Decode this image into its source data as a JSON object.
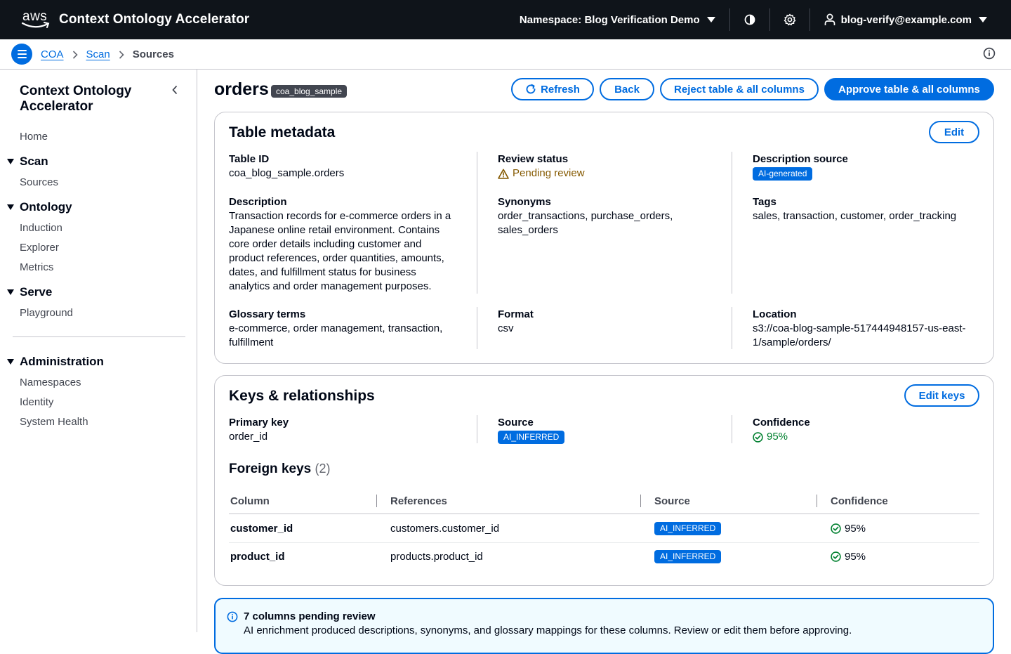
{
  "topnav": {
    "logo_text": "aws",
    "title": "Context Ontology Accelerator",
    "namespace": "Namespace: Blog Verification Demo",
    "user": "blog-verify@example.com"
  },
  "breadcrumb": {
    "items": [
      "COA",
      "Scan"
    ],
    "current": "Sources"
  },
  "sidenav": {
    "title": "Context Ontology Accelerator",
    "home": "Home",
    "sections": [
      {
        "label": "Scan",
        "items": [
          "Sources"
        ]
      },
      {
        "label": "Ontology",
        "items": [
          "Induction",
          "Explorer",
          "Metrics"
        ]
      },
      {
        "label": "Serve",
        "items": [
          "Playground"
        ]
      },
      {
        "label": "Administration",
        "items": [
          "Namespaces",
          "Identity",
          "System Health"
        ]
      }
    ]
  },
  "header": {
    "title": "orders",
    "badge": "coa_blog_sample",
    "buttons": {
      "refresh": "Refresh",
      "back": "Back",
      "reject": "Reject table & all columns",
      "approve": "Approve table & all columns"
    }
  },
  "metadata": {
    "title": "Table metadata",
    "edit": "Edit",
    "table_id_label": "Table ID",
    "table_id": "coa_blog_sample.orders",
    "review_status_label": "Review status",
    "review_status": "Pending review",
    "desc_source_label": "Description source",
    "desc_source": "AI-generated",
    "description_label": "Description",
    "description": "Transaction records for e-commerce orders in a Japanese online retail environment. Contains core order details including customer and product references, order quantities, amounts, dates, and fulfillment status for business analytics and order management purposes.",
    "synonyms_label": "Synonyms",
    "synonyms": "order_transactions, purchase_orders, sales_orders",
    "tags_label": "Tags",
    "tags": "sales, transaction, customer, order_tracking",
    "glossary_label": "Glossary terms",
    "glossary": "e-commerce, order management, transaction, fulfillment",
    "format_label": "Format",
    "format": "csv",
    "location_label": "Location",
    "location": "s3://coa-blog-sample-517444948157-us-east-1/sample/orders/"
  },
  "keys": {
    "title": "Keys & relationships",
    "edit": "Edit keys",
    "pk_label": "Primary key",
    "pk": "order_id",
    "source_label": "Source",
    "source": "AI_INFERRED",
    "confidence_label": "Confidence",
    "confidence": "95%",
    "fk_title": "Foreign keys",
    "fk_count": "(2)",
    "columns": [
      "Column",
      "References",
      "Source",
      "Confidence"
    ],
    "rows": [
      {
        "column": "customer_id",
        "references": "customers.customer_id",
        "source": "AI_INFERRED",
        "confidence": "95%"
      },
      {
        "column": "product_id",
        "references": "products.product_id",
        "source": "AI_INFERRED",
        "confidence": "95%"
      }
    ]
  },
  "alert": {
    "title": "7 columns pending review",
    "body": "AI enrichment produced descriptions, synonyms, and glossary mappings for these columns. Review or edit them before approving."
  },
  "colors": {
    "accent": "#006ce0",
    "topnav_bg": "#0f141a",
    "warning": "#855900",
    "success": "#00802f"
  }
}
